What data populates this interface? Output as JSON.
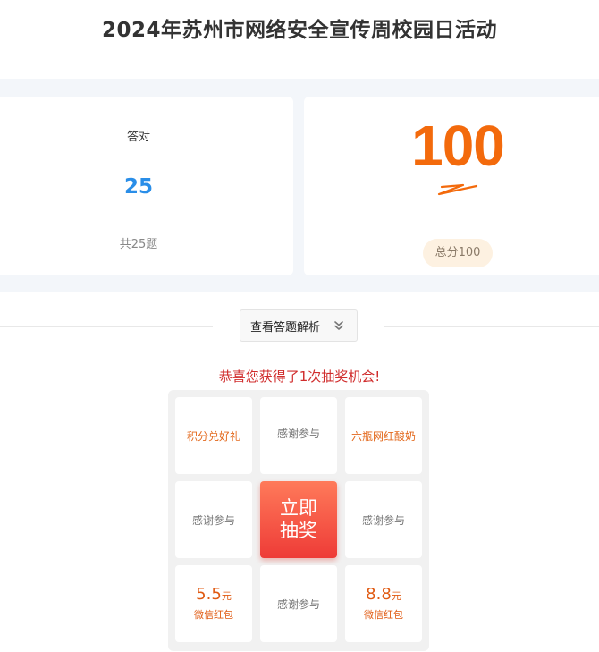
{
  "page": {
    "title": "2024年苏州市网络安全宣传周校园日活动"
  },
  "result": {
    "correct_label": "答对",
    "correct_count": "25",
    "total_questions": "共25题",
    "score": "100",
    "score_total": "总分100"
  },
  "analysis": {
    "button_label": "查看答题解析"
  },
  "lottery": {
    "congrats": "恭喜您获得了1次抽奖机会!",
    "draw_button": [
      "立即",
      "抽奖"
    ],
    "cells": [
      {
        "label": "积分兑好礼"
      },
      {
        "label": "感谢参与"
      },
      {
        "label": "六瓶网红酸奶"
      },
      {
        "label": "感谢参与"
      },
      {
        "label": "感谢参与"
      },
      {
        "amount": "5.5",
        "unit": "元",
        "label": "微信红包"
      },
      {
        "label": "感谢参与"
      },
      {
        "amount": "8.8",
        "unit": "元",
        "label": "微信红包"
      }
    ]
  },
  "colors": {
    "accent_orange": "#f36a0c",
    "correct_blue": "#2a8ee8",
    "congrats_red": "#d02c2c",
    "draw_red": "#ee3b37"
  }
}
